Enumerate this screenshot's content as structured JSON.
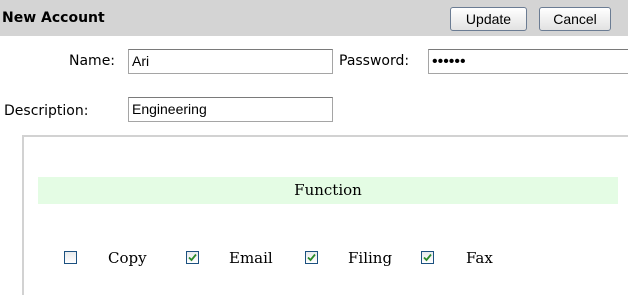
{
  "header": {
    "title": "New Account",
    "update_label": "Update",
    "cancel_label": "Cancel"
  },
  "form": {
    "name_label": "Name:",
    "name_value": "Ari",
    "password_label": "Password:",
    "password_value": "••••••",
    "description_label": "Description:",
    "description_value": "Engineering"
  },
  "functions": {
    "heading": "Function",
    "options": [
      {
        "label": "Copy",
        "checked": false
      },
      {
        "label": "Email",
        "checked": true
      },
      {
        "label": "Filing",
        "checked": true
      },
      {
        "label": "Fax",
        "checked": true
      }
    ]
  },
  "colors": {
    "header_bg": "#d4d4d4",
    "function_band_bg": "#e4fce4",
    "checkbox_check": "#2a8a2a",
    "checkbox_border": "#1c5180"
  }
}
